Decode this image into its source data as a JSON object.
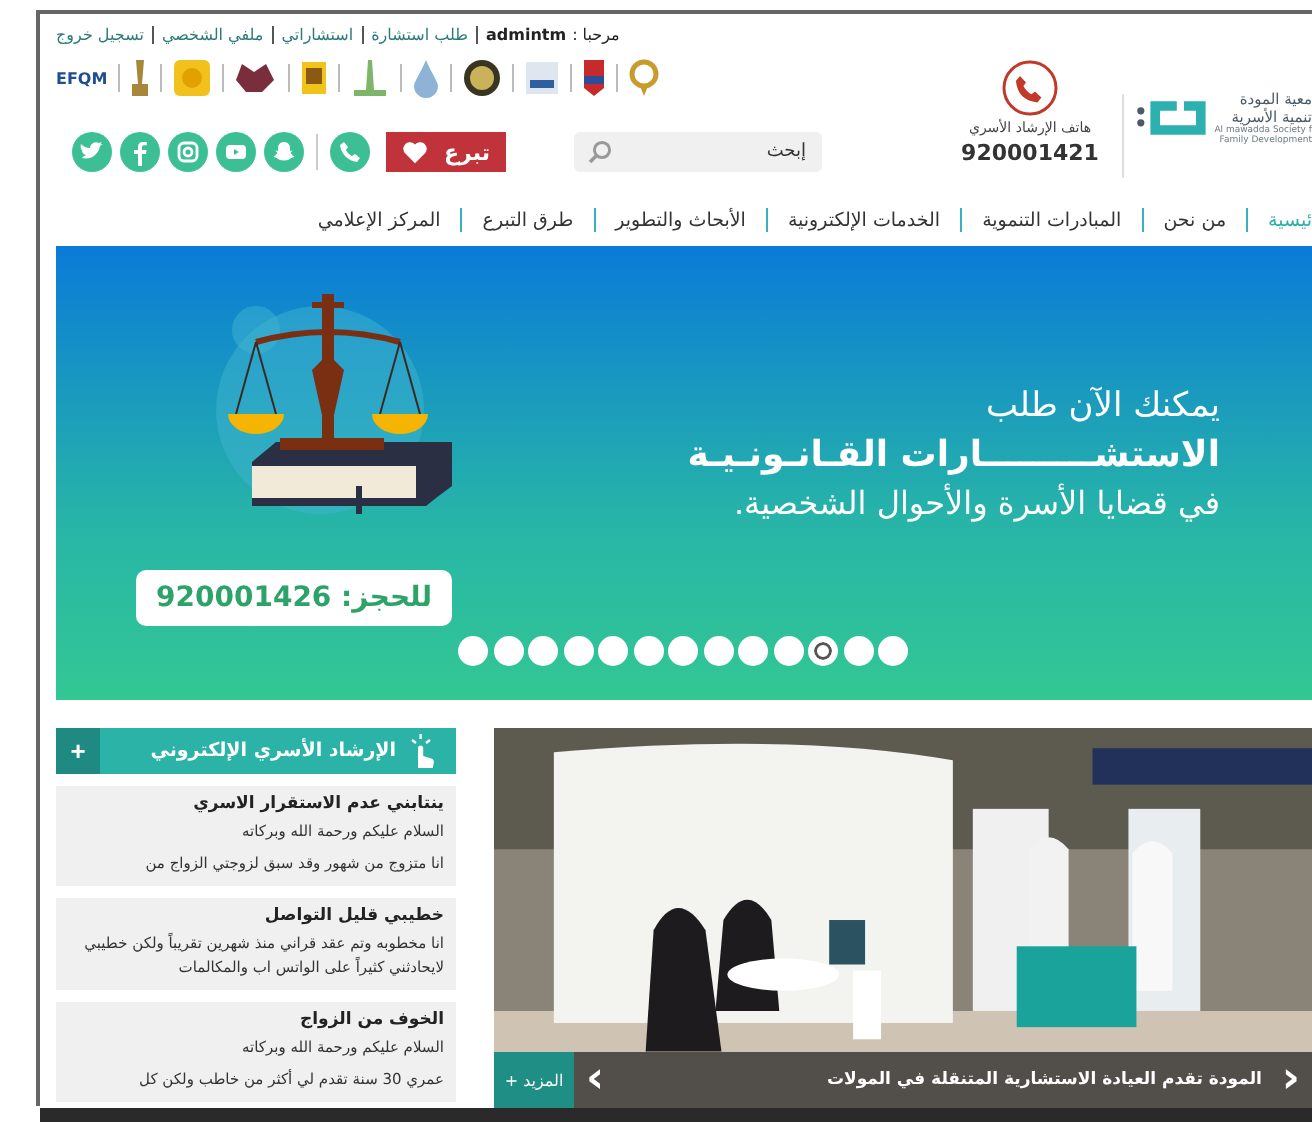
{
  "top_links": [
    {
      "kind": "greeting",
      "label": "مرحبا :"
    },
    {
      "kind": "user",
      "label": "admintm"
    },
    {
      "kind": "link",
      "label": "طلب استشارة"
    },
    {
      "kind": "link",
      "label": "استشاراتي"
    },
    {
      "kind": "link",
      "label": "ملفي الشخصي"
    },
    {
      "kind": "link",
      "label": "تسجيل خروج"
    }
  ],
  "awards": [
    {
      "kind": "ring"
    },
    {
      "kind": "red-badge"
    },
    {
      "kind": "blue-card"
    },
    {
      "kind": "emblem"
    },
    {
      "kind": "drop"
    },
    {
      "kind": "tower"
    },
    {
      "kind": "yellow-card"
    },
    {
      "kind": "stamp"
    },
    {
      "kind": "yellow-square"
    },
    {
      "kind": "trophy"
    },
    {
      "kind": "efqm",
      "label": "EFQM"
    }
  ],
  "search": {
    "placeholder": "إبحث"
  },
  "donate": {
    "label": "تبرع"
  },
  "social": [
    {
      "kind": "phone"
    },
    {
      "kind": "snapchat"
    },
    {
      "kind": "youtube"
    },
    {
      "kind": "instagram"
    },
    {
      "kind": "facebook"
    },
    {
      "kind": "twitter"
    }
  ],
  "hotline": {
    "label": "هاتف الإرشاد الأسري",
    "number": "920001421"
  },
  "logo": {
    "name_line_1": "معية المودة",
    "name_line_2": "تنمية الأسرية",
    "english_1": "Al mawadda Society f",
    "english_2": "Family Development"
  },
  "nav": [
    {
      "label": "ئيسية",
      "selected": true
    },
    {
      "label": "من نحن",
      "selected": false
    },
    {
      "label": "المبادرات التنموية",
      "selected": false
    },
    {
      "label": "الخدمات الإلكترونية",
      "selected": false
    },
    {
      "label": "الأبحاث والتطوير",
      "selected": false
    },
    {
      "label": "طرق التبرع",
      "selected": false
    },
    {
      "label": "المركز الإعلامي",
      "selected": false
    }
  ],
  "banner": {
    "line_1": "يمكنك الآن طلب",
    "line_2": "الاستشـــــــــارات القـانـونـيـة",
    "line_3": "في قضايا الأسرة والأحوال الشخصية.",
    "booking": "للحجز: 920001426",
    "dots": [
      {
        "selected": false
      },
      {
        "selected": false
      },
      {
        "selected": false
      },
      {
        "selected": false
      },
      {
        "selected": false
      },
      {
        "selected": false
      },
      {
        "selected": false
      },
      {
        "selected": false
      },
      {
        "selected": false
      },
      {
        "selected": false
      },
      {
        "selected": true
      },
      {
        "selected": false
      },
      {
        "selected": false
      }
    ]
  },
  "counseling": {
    "title": "الإرشاد الأسري الإلكتروني",
    "add": "+",
    "items": [
      {
        "title": "ينتابني عدم الاستقرار الاسري",
        "body": [
          "السلام عليكم ورحمة الله وبركاته",
          "انا متزوج من شهور وقد سبق لزوجتي الزواج من"
        ]
      },
      {
        "title": "خطيبي قليل التواصل",
        "body": [
          "انا مخطوبه وتم عقد قراني منذ شهرين تقريباً ولكن خطيبي لايحادثني كثيراً على الواتس اب والمكالمات"
        ]
      },
      {
        "title": "الخوف من الزواج",
        "body": [
          "السلام عليكم ورحمة الله وبركاته",
          "عمري 30 سنة تقدم لي أكثر من خاطب ولكن كل"
        ]
      }
    ]
  },
  "news": {
    "kind": "picture",
    "caption": "المودة تقدم العيادة الاستشارية المتنقلة في المولات",
    "more": "+ المزيد",
    "prev": "‹",
    "next": "›"
  }
}
